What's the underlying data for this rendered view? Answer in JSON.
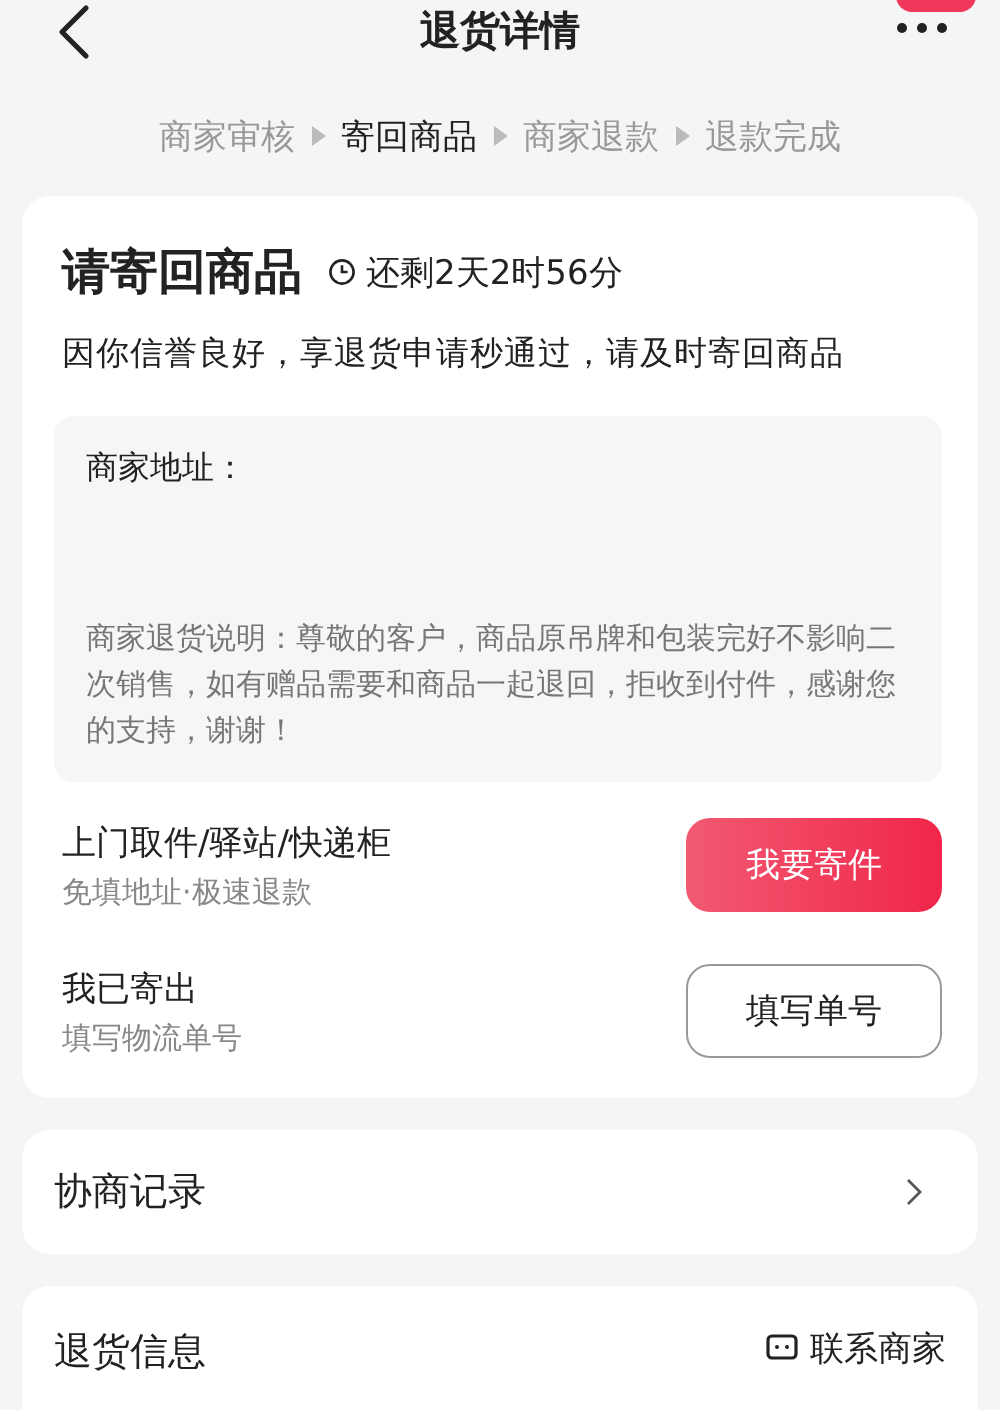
{
  "header": {
    "title": "退货详情"
  },
  "steps": [
    {
      "label": "商家审核",
      "selected": false
    },
    {
      "label": "寄回商品",
      "selected": true
    },
    {
      "label": "商家退款",
      "selected": false
    },
    {
      "label": "退款完成",
      "selected": false
    }
  ],
  "return_card": {
    "title": "请寄回商品",
    "countdown": "还剩2天2时56分",
    "subtitle": "因你信誉良好，享退货申请秒通过，请及时寄回商品",
    "address_label": "商家地址：",
    "note": "商家退货说明：尊敬的客户，商品原吊牌和包装完好不影响二次销售，如有赠品需要和商品一起退回，拒收到付件，感谢您的支持，谢谢！",
    "options": [
      {
        "kind": "primary",
        "title": "上门取件/驿站/快递柜",
        "desc": "免填地址·极速退款",
        "button": "我要寄件"
      },
      {
        "kind": "outline",
        "title": "我已寄出",
        "desc": "填写物流单号",
        "button": "填写单号"
      }
    ]
  },
  "negotiation": {
    "title": "协商记录"
  },
  "return_info": {
    "title": "退货信息",
    "contact": "联系商家"
  }
}
